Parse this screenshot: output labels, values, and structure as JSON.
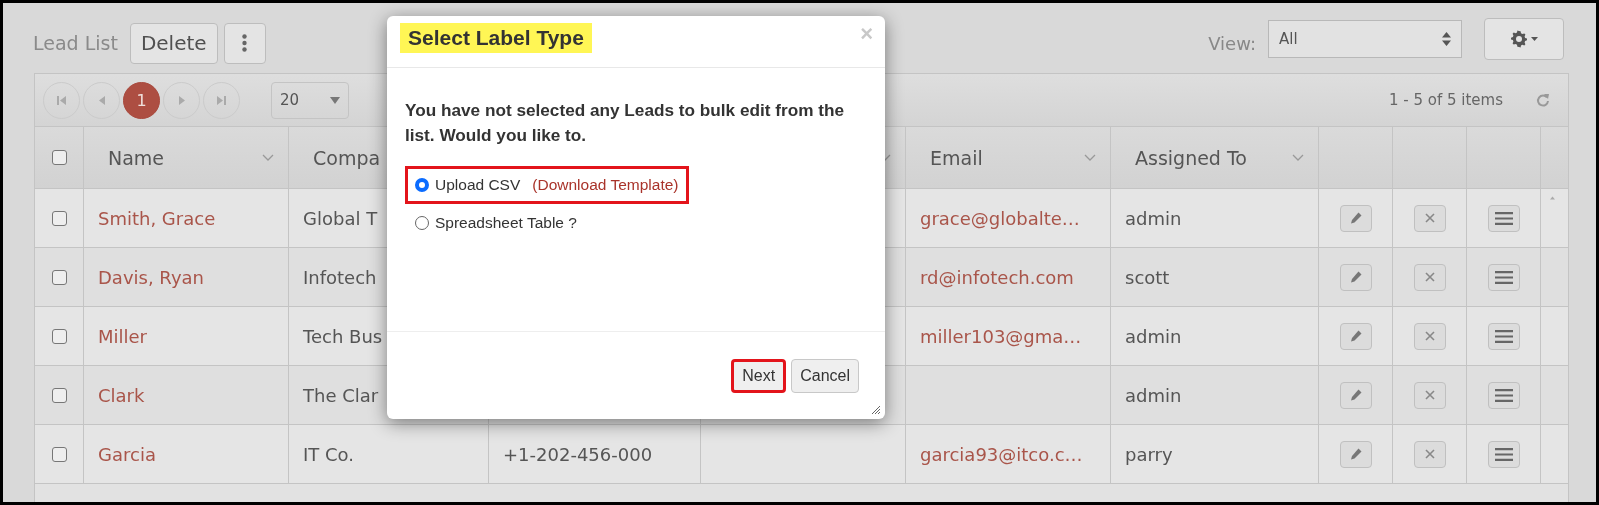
{
  "toolbar": {
    "title": "Lead List",
    "delete_button": "Delete",
    "view_label": "View:",
    "view_value": "All"
  },
  "pager": {
    "pages": [
      {
        "label": "1",
        "selected": true
      }
    ],
    "page_size": "20",
    "summary": "1 - 5 of 5 items"
  },
  "table": {
    "header_checked": false,
    "headers": {
      "name": "Name",
      "company": "Compa",
      "email": "Email",
      "assigned_to": "Assigned To"
    },
    "rows": [
      {
        "checked": false,
        "name": "Smith, Grace",
        "company": "Global T",
        "email": "grace@globalte…",
        "assigned_to": "admin"
      },
      {
        "checked": false,
        "name": "Davis, Ryan",
        "company": "Infotech",
        "email": "rd@infotech.com",
        "assigned_to": "scott"
      },
      {
        "checked": false,
        "name": "Miller",
        "company": "Tech Bus",
        "email": "miller103@gma…",
        "assigned_to": "admin"
      },
      {
        "checked": false,
        "name": "Clark",
        "company": "The Clar",
        "assigned_to": "admin"
      },
      {
        "checked": false,
        "name": "Garcia",
        "company": "IT Co.",
        "phone": "+1-202-456-000",
        "email": "garcia93@itco.c…",
        "assigned_to": "parry"
      }
    ]
  },
  "modal": {
    "title": "Select Label Type",
    "title_highlighted": true,
    "close": "×",
    "message": "You have not selected any Leads to bulk edit from the list. Would you like to.",
    "options": [
      {
        "label": "Upload CSV",
        "link": "(Download Template)",
        "selected": true,
        "highlighted": true
      },
      {
        "label": "Spreadsheet Table ?",
        "selected": false,
        "highlighted": false
      }
    ],
    "buttons": [
      {
        "label": "Next",
        "highlighted": true
      },
      {
        "label": "Cancel",
        "highlighted": false
      }
    ]
  }
}
